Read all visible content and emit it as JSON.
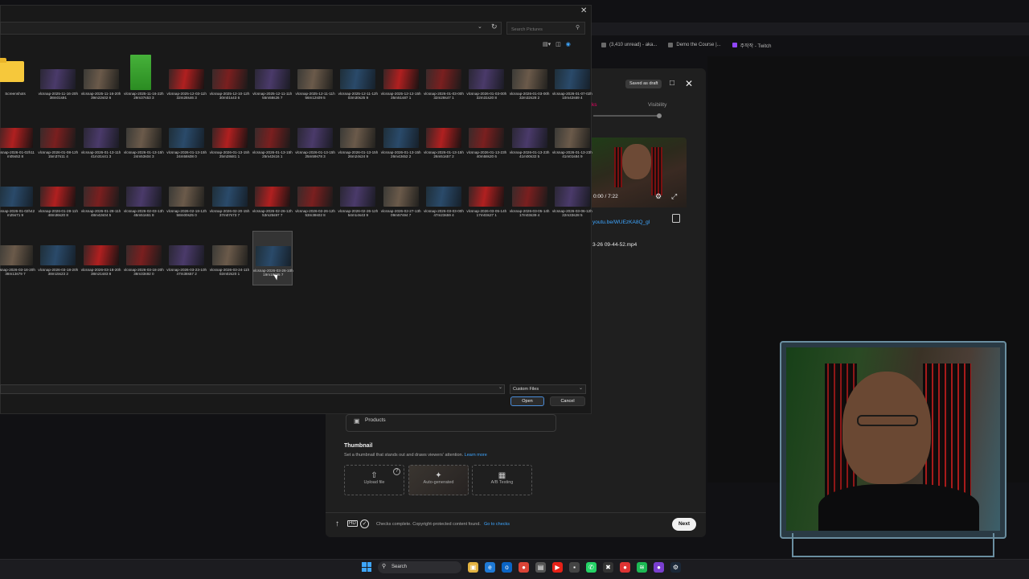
{
  "browser": {
    "tabs": [
      {
        "label": "(3,410 unread) - aka...",
        "icon": "mail-icon"
      },
      {
        "label": "Demo the Course |...",
        "icon": "globe-icon"
      },
      {
        "label": "주작작 - Twitch",
        "icon": "twitch-icon"
      }
    ]
  },
  "youtube": {
    "saved_badge": "Saved as draft",
    "steps": {
      "checks": "ks",
      "visibility": "Visibility"
    },
    "preview_time": "0:00 / 7:22",
    "video_link": "youtu.be/WUEzKA8Q_gI",
    "filename": "3-26 09-44-52.mp4",
    "products_label": "Products",
    "thumbnail": {
      "title": "Thumbnail",
      "description": "Set a thumbnail that stands out and draws viewers' attention.",
      "learn_more": "Learn more",
      "options": [
        "Upload file",
        "Auto-generated",
        "A/B Testing"
      ]
    },
    "checks_text": "Checks complete. Copyright-protected content found.",
    "checks_link": "Go to checks",
    "next_label": "Next"
  },
  "file_dialog": {
    "search_placeholder": "Search Pictures",
    "filter_value": "Custom Files",
    "open_label": "Open",
    "cancel_label": "Cancel",
    "files": [
      "Screenshots",
      "vlcsnap-2025-11-16-20h38m01s91",
      "vlcsnap-2025-11-16-20h39m22s02 6",
      "vlcsnap-2025-11-16-22h29m37s53 3",
      "vlcsnap-2025-12-03-11h32m28s46 3",
      "vlcsnap-2025-12-10-12h30m01s43 6",
      "vlcsnap-2025-12-11-11h55m58s26 7",
      "vlcsnap-2025-12-11-11h56m12s09 5",
      "vlcsnap-2025-12-11-12h03m30s25 9",
      "vlcsnap-2025-12-12-15h35m51s87 1",
      "vlcsnap-2026-01-03-00h32m28s47 1",
      "vlcsnap-2026-01-03-00h32m31s20 8",
      "vlcsnap-2026-01-03-00h32m32s28 2",
      "vlcsnap-2026-01-07-02h10m42s69 4",
      "vlcsnap-2026-01-02h11m05s52 8",
      "vlcsnap-2026-01-08-12h15m37s11 4",
      "vlcsnap-2026-01-13-11h41m31s41 3",
      "vlcsnap-2026-01-13-15h24m53s04 3",
      "vlcsnap-2026-01-13-15h24m58s08 0",
      "vlcsnap-2026-01-13-15h25m28s81 1",
      "vlcsnap-2026-01-13-15h25m42s16 1",
      "vlcsnap-2026-01-13-15h25m59s78 3",
      "vlcsnap-2026-01-13-15h26m24s24 9",
      "vlcsnap-2026-01-13-15h26m43s52 2",
      "vlcsnap-2026-01-13-15h26m51s57 2",
      "vlcsnap-2026-01-13-23h40m58s20 6",
      "vlcsnap-2026-01-13-23h41m00s32 5",
      "vlcsnap-2026-01-13-23h41m01s84 9",
      "vlcsnap-2026-01-02h42m25s71 9",
      "vlcsnap-2026-01-28-11h48m36s20 8",
      "vlcsnap-2026-01-28-11h48m42s04 5",
      "vlcsnap-2026-02-03-13h45m51s61 8",
      "vlcsnap-2026-02-18-12h58m00s25 0",
      "vlcsnap-2026-02-20-15h37m07s73 7",
      "vlcsnap-2026-02-26-12h53m25s97 7",
      "vlcsnap-2026-02-26-12h53m38s02 8",
      "vlcsnap-2026-02-26-12h54m14s43 9",
      "vlcsnap-2026-02-27-13h09m57s94 7",
      "vlcsnap-2026-03-03-00h47m23s59 4",
      "vlcsnap-2026-03-05-14h17m03s27 1",
      "vlcsnap-2026-03-05-14h17m03s39 4",
      "vlcsnap-2026-03-06-12h22m33s28 5",
      "vlcsnap-2026-03-18-20h38m13s79 7",
      "vlcsnap-2026-03-18-20h38m15s23 2",
      "vlcsnap-2026-03-18-20h38m21s83 8",
      "vlcsnap-2026-03-18-20h38m33s92 0",
      "vlcsnap-2026-03-23-10h47m38s57 2",
      "vlcsnap-2026-03-24-11h02m02s20 1",
      "vlcsnap-2026-03-26-10h19m18s95 7"
    ]
  },
  "taskbar": {
    "search_label": "Search"
  }
}
